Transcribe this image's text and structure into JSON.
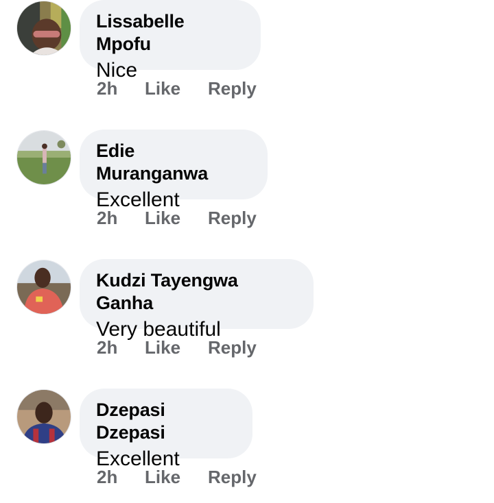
{
  "comments": [
    {
      "author": "Lissabelle Mpofu",
      "text": "Nice",
      "time": "2h",
      "like_label": "Like",
      "reply_label": "Reply",
      "avatar_icon": "profile-photo"
    },
    {
      "author": "Edie Muranganwa",
      "text": "Excellent",
      "time": "2h",
      "like_label": "Like",
      "reply_label": "Reply",
      "avatar_icon": "profile-photo"
    },
    {
      "author": "Kudzi Tayengwa Ganha",
      "text": "Very beautiful",
      "time": "2h",
      "like_label": "Like",
      "reply_label": "Reply",
      "avatar_icon": "profile-photo"
    },
    {
      "author": "Dzepasi Dzepasi",
      "text": "Excellent",
      "time": "2h",
      "like_label": "Like",
      "reply_label": "Reply",
      "avatar_icon": "profile-photo"
    }
  ],
  "colors": {
    "bubble_bg": "#f0f2f5",
    "author_text": "#050505",
    "meta_text": "#65676b"
  }
}
